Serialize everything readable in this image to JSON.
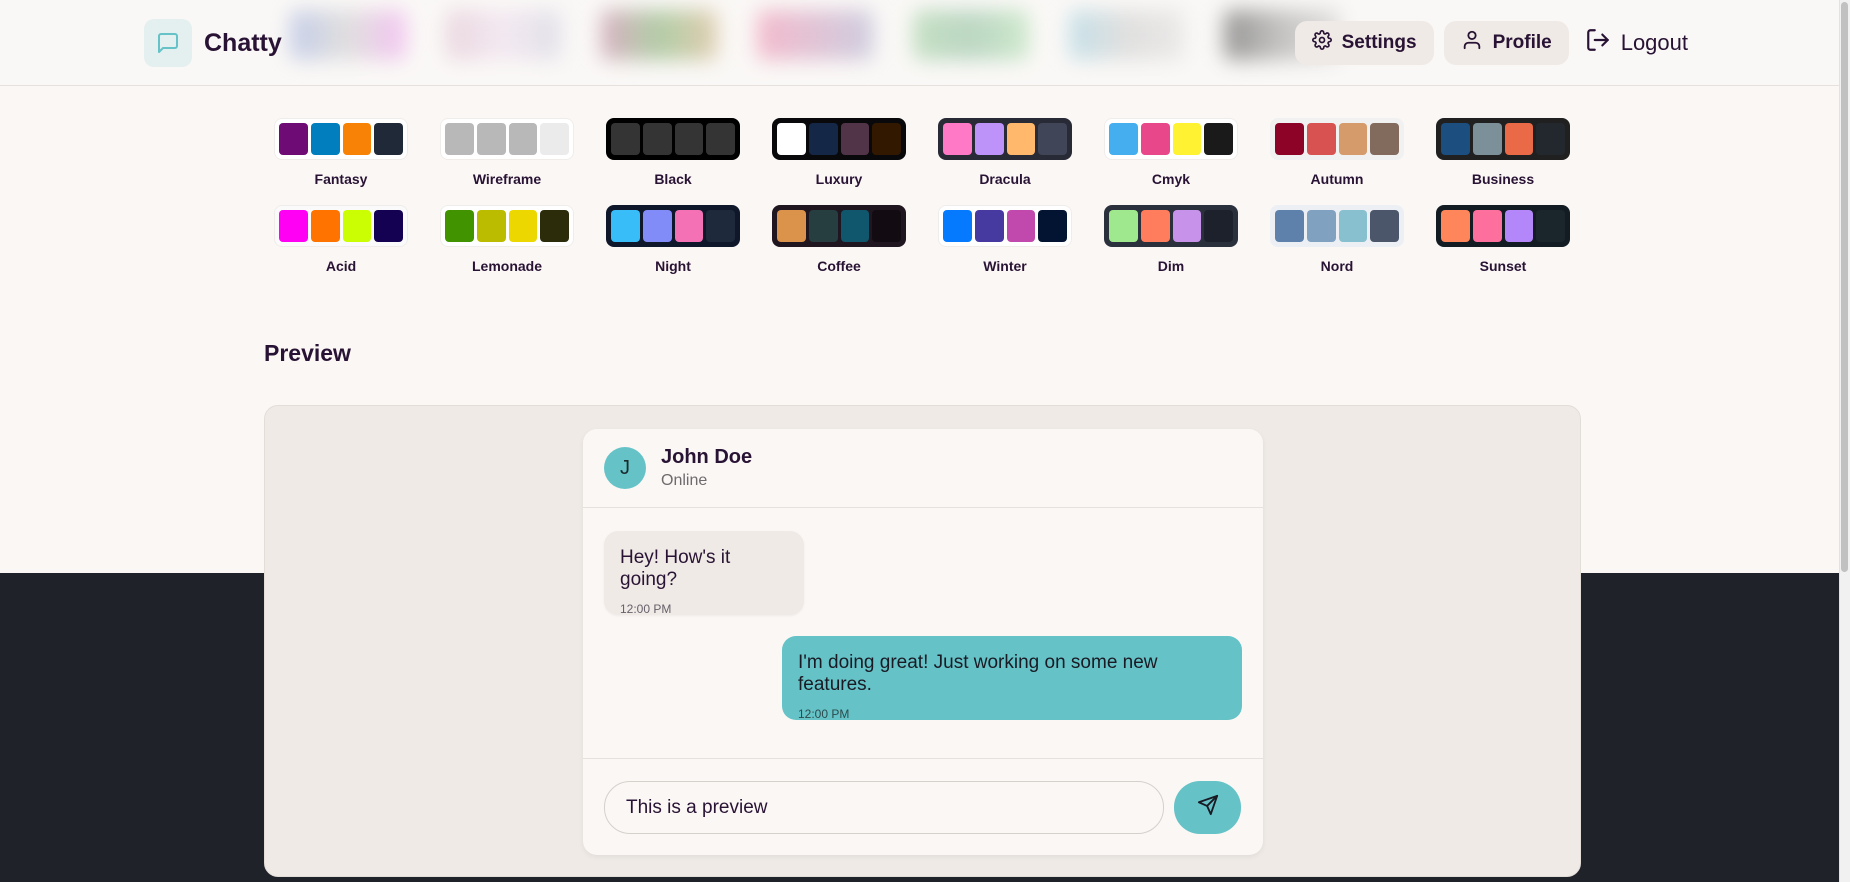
{
  "header": {
    "brand": "Chatty",
    "settings_label": "Settings",
    "profile_label": "Profile",
    "logout_label": "Logout"
  },
  "themes": [
    {
      "name": "Fantasy",
      "bg": "#ffffff",
      "colors": [
        "#6e0b75",
        "#007ebd",
        "#f78205",
        "#1f2937"
      ]
    },
    {
      "name": "Wireframe",
      "bg": "#ffffff",
      "colors": [
        "#b8b8b8",
        "#b8b8b8",
        "#b8b8b8",
        "#ebebeb"
      ]
    },
    {
      "name": "Black",
      "bg": "#000000",
      "colors": [
        "#343434",
        "#343434",
        "#343434",
        "#343434"
      ]
    },
    {
      "name": "Luxury",
      "bg": "#09090b",
      "colors": [
        "#ffffff",
        "#152747",
        "#513448",
        "#331800"
      ]
    },
    {
      "name": "Dracula",
      "bg": "#282a36",
      "colors": [
        "#ff79c6",
        "#bd93f9",
        "#ffb86c",
        "#414558"
      ]
    },
    {
      "name": "Cmyk",
      "bg": "#ffffff",
      "colors": [
        "#45aeee",
        "#e8488a",
        "#fff232",
        "#1a1a1a"
      ]
    },
    {
      "name": "Autumn",
      "bg": "#f1f1f1",
      "colors": [
        "#8c0327",
        "#d85251",
        "#d59b6a",
        "#826a5c"
      ]
    },
    {
      "name": "Business",
      "bg": "#202020",
      "colors": [
        "#1c4e80",
        "#7c909a",
        "#ea6947",
        "#23282e"
      ]
    },
    {
      "name": "Acid",
      "bg": "#fafafa",
      "colors": [
        "#ff00f4",
        "#ff7400",
        "#cbfd03",
        "#140152"
      ]
    },
    {
      "name": "Lemonade",
      "bg": "#ffffff",
      "colors": [
        "#419400",
        "#bbbb00",
        "#ecd800",
        "#2d2c0a"
      ]
    },
    {
      "name": "Night",
      "bg": "#0f172a",
      "colors": [
        "#38bdf8",
        "#818cf8",
        "#f471b5",
        "#1e293b"
      ]
    },
    {
      "name": "Coffee",
      "bg": "#20161f",
      "colors": [
        "#db924b",
        "#263e3f",
        "#10576d",
        "#120c12"
      ]
    },
    {
      "name": "Winter",
      "bg": "#ffffff",
      "colors": [
        "#057aff",
        "#463aa1",
        "#c149ad",
        "#021431"
      ]
    },
    {
      "name": "Dim",
      "bg": "#2a303c",
      "colors": [
        "#9fe88d",
        "#ff7d5c",
        "#c792e9",
        "#1c212b"
      ]
    },
    {
      "name": "Nord",
      "bg": "#eceff4",
      "colors": [
        "#5e81ac",
        "#81a1c1",
        "#88c0d0",
        "#4c566a"
      ]
    },
    {
      "name": "Sunset",
      "bg": "#121c22",
      "colors": [
        "#ff865b",
        "#fd6f9c",
        "#b387fa",
        "#1b262c"
      ]
    }
  ],
  "preview": {
    "title": "Preview",
    "contact_initial": "J",
    "contact_name": "John Doe",
    "contact_status": "Online",
    "messages": [
      {
        "text": "Hey! How's it going?",
        "time": "12:00 PM"
      },
      {
        "text": "I'm doing great! Just working on some new features.",
        "time": "12:00 PM"
      }
    ],
    "input_value": "This is a preview"
  },
  "colors": {
    "primary": "#65c3c8",
    "base_bg": "#faf7f5",
    "base_200": "#efeae6",
    "text": "#291334",
    "dark_backdrop": "#1f2329"
  },
  "icons": {
    "brand": "message-square-icon",
    "settings": "gear-icon",
    "profile": "user-icon",
    "logout": "logout-icon",
    "send": "send-icon"
  }
}
